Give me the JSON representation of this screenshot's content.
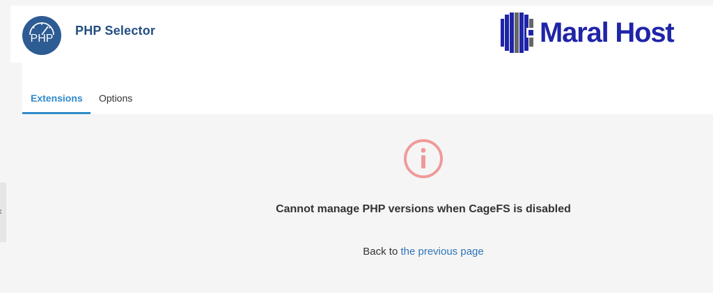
{
  "header": {
    "title": "PHP Selector",
    "php_logo_text": "PHP",
    "brand_name": "Maral Host"
  },
  "tabs": [
    {
      "label": "Extensions",
      "active": true
    },
    {
      "label": "Options",
      "active": false
    }
  ],
  "message": {
    "icon": "info-circle-icon",
    "text": "Cannot manage PHP versions when CageFS is disabled",
    "back_prefix": "Back to",
    "back_link_text": "the previous page"
  },
  "side_handle": {
    "glyph": "‹"
  },
  "colors": {
    "title": "#234e82",
    "active_tab": "#2f8ac9",
    "php_logo": "#2d5b93",
    "info_icon": "#ef9a9a",
    "brand": "#1f25a8",
    "link": "#2f74b8"
  }
}
